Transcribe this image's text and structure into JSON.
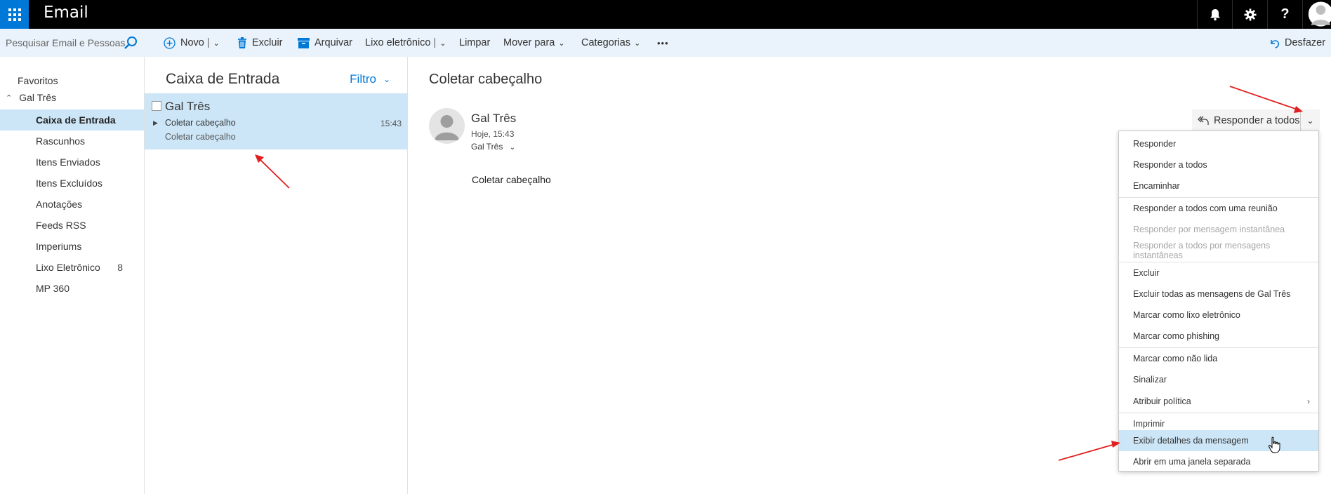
{
  "topbar": {
    "app_title": "Email",
    "help_label": "?",
    "icons": [
      "app-launcher-icon",
      "bell-icon",
      "gear-icon",
      "help-icon",
      "user-avatar"
    ]
  },
  "search": {
    "placeholder": "Pesquisar Email e Pessoas"
  },
  "commands": {
    "new": "Novo",
    "delete": "Excluir",
    "archive": "Arquivar",
    "junk": "Lixo eletrônico",
    "sweep": "Limpar",
    "move": "Mover para",
    "categories": "Categorias",
    "more": "•••",
    "undo": "Desfazer"
  },
  "folders": {
    "favorites_label": "Favoritos",
    "account_label": "Gal Três",
    "items": [
      {
        "label": "Caixa de Entrada",
        "count": "",
        "selected": true
      },
      {
        "label": "Rascunhos",
        "count": ""
      },
      {
        "label": "Itens Enviados",
        "count": ""
      },
      {
        "label": "Itens Excluídos",
        "count": ""
      },
      {
        "label": "Anotações",
        "count": ""
      },
      {
        "label": "Feeds RSS",
        "count": ""
      },
      {
        "label": "Imperiums",
        "count": ""
      },
      {
        "label": "Lixo Eletrônico",
        "count": "8"
      },
      {
        "label": "MP 360",
        "count": ""
      }
    ]
  },
  "message_list": {
    "title": "Caixa de Entrada",
    "filter_label": "Filtro",
    "messages": [
      {
        "sender": "Gal Três",
        "subject": "Coletar cabeçalho",
        "preview": "Coletar cabeçalho",
        "time": "15:43"
      }
    ]
  },
  "reading_pane": {
    "subject": "Coletar cabeçalho",
    "sender": "Gal Três",
    "date": "Hoje, 15:43",
    "to": "Gal Três",
    "body": "Coletar cabeçalho",
    "reply_all_label": "Responder a todos"
  },
  "menu": {
    "items": [
      {
        "label": "Responder"
      },
      {
        "label": "Responder a todos"
      },
      {
        "label": "Encaminhar"
      },
      {
        "label": "Responder a todos com uma reunião"
      },
      {
        "label": "Responder por mensagem instantânea",
        "disabled": true
      },
      {
        "label": "Responder a todos por mensagens instantâneas",
        "disabled": true
      },
      {
        "label": "Excluir"
      },
      {
        "label": "Excluir todas as mensagens de Gal Três"
      },
      {
        "label": "Marcar como lixo eletrônico"
      },
      {
        "label": "Marcar como phishing"
      },
      {
        "label": "Marcar como não lida"
      },
      {
        "label": "Sinalizar"
      },
      {
        "label": "Atribuir política",
        "submenu": true
      },
      {
        "label": "Imprimir"
      },
      {
        "label": "Exibir detalhes da mensagem",
        "highlighted": true
      },
      {
        "label": "Abrir em uma janela separada"
      }
    ]
  },
  "colors": {
    "accent": "#0078d7",
    "selection": "#cde6f7",
    "command_bar": "#eaf3fb",
    "topbar": "#000000",
    "annotation_arrow": "#e02020"
  }
}
